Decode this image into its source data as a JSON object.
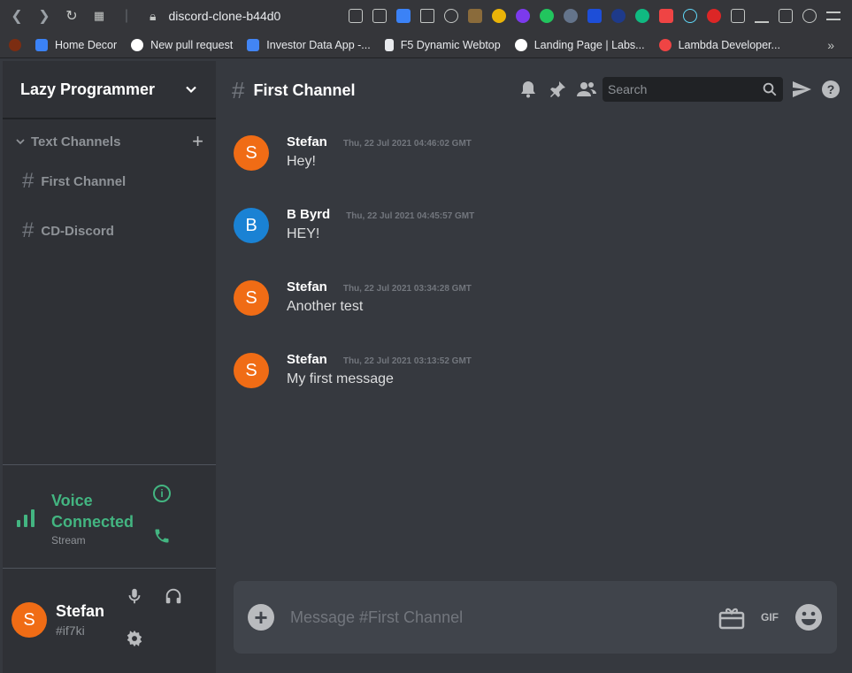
{
  "browser": {
    "url": "discord-clone-b44d0",
    "bookmarks": [
      {
        "label": "Home Decor",
        "color": "#3b82f6"
      },
      {
        "label": "New pull request",
        "color": "#ffffff"
      },
      {
        "label": "Investor Data App -...",
        "color": "#4285f4"
      },
      {
        "label": "F5 Dynamic Webtop",
        "color": "#e8eaed"
      },
      {
        "label": "Landing Page | Labs...",
        "color": "#ffffff"
      },
      {
        "label": "Lambda Developer...",
        "color": "#ef4444"
      }
    ],
    "more": "»"
  },
  "server": {
    "name": "Lazy Programmer",
    "category": "Text Channels",
    "channels": [
      {
        "name": "First Channel"
      },
      {
        "name": "CD-Discord"
      }
    ]
  },
  "voice": {
    "status": "Voice Connected",
    "sub": "Stream"
  },
  "user": {
    "initial": "S",
    "name": "Stefan",
    "tag": "#if7ki"
  },
  "channel": {
    "title": "First Channel",
    "search_placeholder": "Search"
  },
  "messages": [
    {
      "initial": "S",
      "author": "Stefan",
      "timestamp": "Thu, 22 Jul 2021 04:46:02 GMT",
      "text": "Hey!",
      "color": "#f06c15"
    },
    {
      "initial": "B",
      "author": "B Byrd",
      "timestamp": "Thu, 22 Jul 2021 04:45:57 GMT",
      "text": "HEY!",
      "color": "#1a82d4"
    },
    {
      "initial": "S",
      "author": "Stefan",
      "timestamp": "Thu, 22 Jul 2021 03:34:28 GMT",
      "text": "Another test",
      "color": "#f06c15"
    },
    {
      "initial": "S",
      "author": "Stefan",
      "timestamp": "Thu, 22 Jul 2021 03:13:52 GMT",
      "text": "My first message",
      "color": "#f06c15"
    }
  ],
  "composer": {
    "placeholder": "Message #First Channel",
    "gif_label": "GIF"
  },
  "colors": {
    "accent_green": "#43b581",
    "avatar_orange": "#f06c15",
    "avatar_blue": "#1a82d4"
  }
}
